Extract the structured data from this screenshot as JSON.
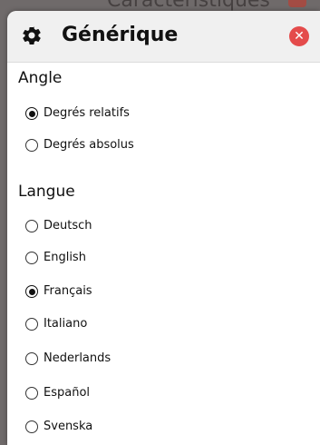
{
  "background": {
    "title_fragment": "Caractéristiques"
  },
  "panel": {
    "icon": "gear-icon",
    "title": "Générique",
    "close_icon": "close-icon",
    "accent_close": "#e44b4b"
  },
  "angle": {
    "heading": "Angle",
    "options": [
      {
        "label": "Degrés relatifs",
        "checked": true
      },
      {
        "label": "Degrés absolus",
        "checked": false
      }
    ]
  },
  "language": {
    "heading": "Langue",
    "options": [
      {
        "label": "Deutsch",
        "checked": false
      },
      {
        "label": "English",
        "checked": false
      },
      {
        "label": "Français",
        "checked": true
      },
      {
        "label": "Italiano",
        "checked": false
      },
      {
        "label": "Nederlands",
        "checked": false
      },
      {
        "label": "Español",
        "checked": false
      },
      {
        "label": "Svenska",
        "checked": false
      }
    ]
  }
}
